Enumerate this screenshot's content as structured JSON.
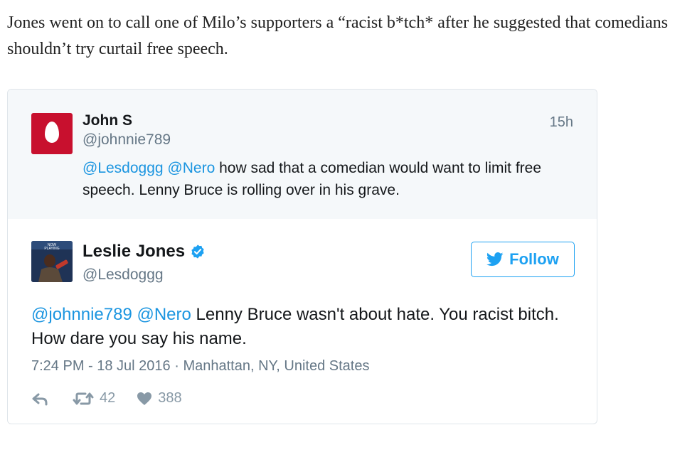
{
  "article": {
    "paragraph": "Jones went on to call one of Milo’s supporters a “racist b*tch* after he suggested that comedians shouldn’t try curtail free speech."
  },
  "quoted_tweet": {
    "name": "John S",
    "handle": "@johnnie789",
    "time": "15h",
    "mention1": "@Lesdoggg",
    "mention2": "@Nero",
    "text": " how sad that a comedian would want to limit free speech. Lenny Bruce is rolling over in his grave."
  },
  "tweet": {
    "name": "Leslie Jones",
    "handle": "@Lesdoggg",
    "follow_label": "Follow",
    "mention1": "@johnnie789",
    "mention2": "@Nero",
    "text": " Lenny Bruce wasn't about hate. You racist bitch. How dare you say his name.",
    "meta": "7:24 PM - 18 Jul 2016 · Manhattan, NY, United States",
    "retweets": "42",
    "likes": "388"
  },
  "colors": {
    "accent": "#1da1f2",
    "mention": "#1b95e0",
    "avatar_red": "#c8102e",
    "quoted_bg": "#f5f8fa"
  },
  "icons": [
    "egg-avatar",
    "verified-badge-icon",
    "twitter-bird-icon",
    "reply-icon",
    "retweet-icon",
    "heart-icon"
  ]
}
